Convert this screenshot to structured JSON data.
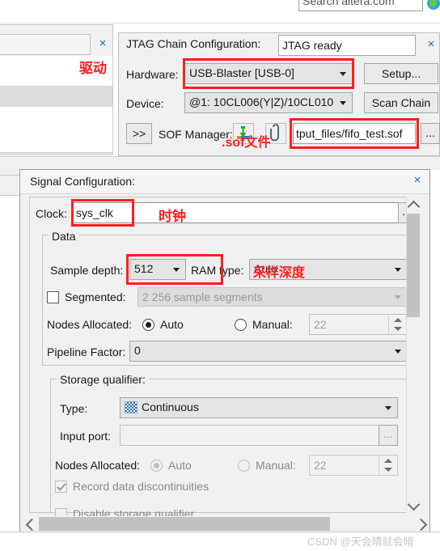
{
  "browser": {
    "search_placeholder": "Search altera.com",
    "globe_icon": "globe-icon"
  },
  "left_window": {
    "close_label": "×",
    "annotation": "驱动"
  },
  "jtag_panel": {
    "title": "JTAG Chain Configuration:",
    "status": "JTAG ready",
    "close_label": "×",
    "hardware_label": "Hardware:",
    "hardware_value": "USB-Blaster [USB-0]",
    "setup_button": "Setup...",
    "device_label": "Device:",
    "device_value": "@1: 10CL006(Y|Z)/10CL010",
    "scan_chain_button": "Scan Chain",
    "expand_button": ">>",
    "sof_manager_label": "SOF Manager:",
    "program_icon": "program-device-icon",
    "attach_icon": "paperclip-icon",
    "sof_path": "tput_files/fifo_test.sof",
    "browse_button": "...",
    "annotation": ".sof文件"
  },
  "signal_config": {
    "title": "Signal Configuration:",
    "close_label": "×",
    "clock_label": "Clock:",
    "clock_value": "sys_clk",
    "clock_browse": "...",
    "clock_annotation": "时钟",
    "data_group_label": "Data",
    "sample_depth_label": "Sample depth:",
    "sample_depth_value": "512",
    "ram_type_label": "RAM type:",
    "ram_type_value": "Auto",
    "sample_depth_annotation": "采样深度",
    "segmented_label": "Segmented:",
    "segmented_checked": false,
    "segmented_value": "2  256 sample segments",
    "nodes_allocated_label": "Nodes Allocated:",
    "nodes_auto_label": "Auto",
    "nodes_manual_label": "Manual:",
    "nodes_manual_value": "22",
    "pipeline_factor_label": "Pipeline Factor:",
    "pipeline_factor_value": "0",
    "storage_qualifier_label": "Storage qualifier:",
    "sq_type_label": "Type:",
    "sq_type_value": "Continuous",
    "sq_type_icon": "continuous-checker-icon",
    "sq_input_port_label": "Input port:",
    "sq_input_port_value": "",
    "sq_input_browse": "...",
    "sq_nodes_allocated_label": "Nodes Allocated:",
    "sq_nodes_auto_label": "Auto",
    "sq_nodes_manual_label": "Manual:",
    "sq_nodes_manual_value": "22",
    "record_discontinuities_label": "Record data discontinuities",
    "record_discontinuities_checked": true,
    "disable_storage_qualifier_label": "Disable storage qualifier",
    "disable_storage_qualifier_checked": false
  },
  "watermark": "CSDN @天会晴就会暗",
  "colors": {
    "annotation_red": "#ff1e1e",
    "link_blue": "#1b6ec2",
    "panel_gray": "#f0f0f0",
    "accent_checker": "#1e63b0"
  }
}
